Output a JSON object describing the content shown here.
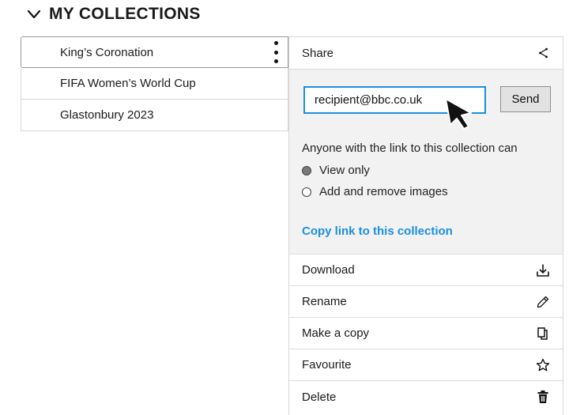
{
  "header": {
    "title": "MY COLLECTIONS",
    "chevron_icon": "chevron-down-icon"
  },
  "collections": [
    {
      "label": "King’s Coronation"
    },
    {
      "label": "FIFA Women’s World Cup"
    },
    {
      "label": "Glastonbury 2023"
    }
  ],
  "share": {
    "title": "Share",
    "email_value": "recipient@bbc.co.uk",
    "send_label": "Send",
    "permission_text": "Anyone with the link to this collection can",
    "options": [
      {
        "label": "View only",
        "checked": true
      },
      {
        "label": "Add and remove images",
        "checked": false
      }
    ],
    "copy_link_label": "Copy link to this collection"
  },
  "actions": [
    {
      "label": "Download",
      "icon": "download-icon"
    },
    {
      "label": "Rename",
      "icon": "pencil-icon"
    },
    {
      "label": "Make a copy",
      "icon": "copy-icon"
    },
    {
      "label": "Favourite",
      "icon": "star-icon"
    },
    {
      "label": "Delete",
      "icon": "trash-icon"
    }
  ],
  "colors": {
    "accent": "#1b8fe0",
    "panel_bg": "#f2f2f2",
    "border": "#d6d6d6"
  }
}
